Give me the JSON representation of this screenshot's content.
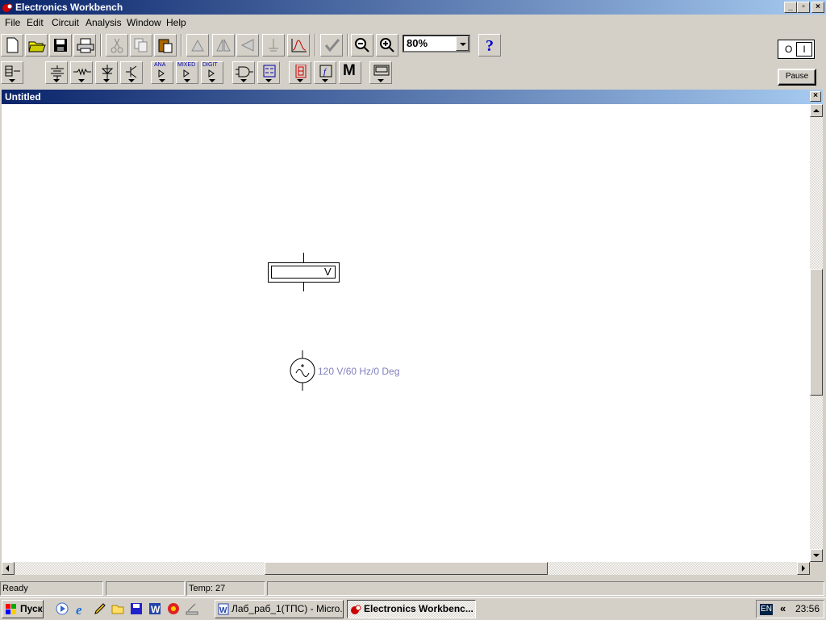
{
  "app": {
    "title": "Electronics Workbench"
  },
  "menu": [
    "File",
    "Edit",
    "Circuit",
    "Analysis",
    "Window",
    "Help"
  ],
  "toolbar": {
    "zoom": "80%",
    "power": {
      "off_label": "O",
      "on_label": "I"
    },
    "pause_label": "Pause",
    "bin_labels": {
      "analog": "ANA",
      "mixed": "MIXED",
      "digital": "DIGIT",
      "misc": "M"
    }
  },
  "document": {
    "title": "Untitled"
  },
  "circuit": {
    "voltmeter_unit": "V",
    "ac_source_label": "120 V/60 Hz/0 Deg"
  },
  "status": {
    "text": "Ready",
    "temp": "Temp:  27"
  },
  "taskbar": {
    "start": "Пуск",
    "tasks": [
      {
        "label": "Лаб_раб_1(ТПС) - Micro..."
      },
      {
        "label": "Electronics Workbenc..."
      }
    ],
    "lang": "EN",
    "clock": "23:56"
  },
  "colors": {
    "titlebar": "#0a246a",
    "component_label": "#7f7fbf"
  }
}
